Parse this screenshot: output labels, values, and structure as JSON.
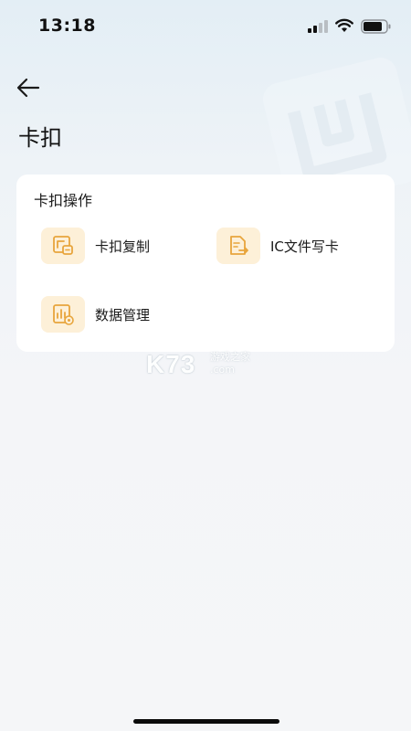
{
  "status_bar": {
    "time": "13:18",
    "icons": [
      "signal-icon",
      "wifi-icon",
      "battery-icon"
    ]
  },
  "header": {
    "back_icon": "arrow-left-icon",
    "title": "卡扣"
  },
  "card": {
    "title": "卡扣操作",
    "actions": [
      {
        "label": "卡扣复制",
        "icon": "card-copy-icon"
      },
      {
        "label": "IC文件写卡",
        "icon": "file-write-icon"
      },
      {
        "label": "数据管理",
        "icon": "data-manage-icon"
      }
    ]
  },
  "watermark": {
    "brand": "K73",
    "text_line1": "游戏之家",
    "text_line2": ".com"
  },
  "colors": {
    "accent": "#e8a53c",
    "icon_bg": "#fdf0d8",
    "card_bg": "#ffffff",
    "page_bg": "#f5f6f8"
  }
}
